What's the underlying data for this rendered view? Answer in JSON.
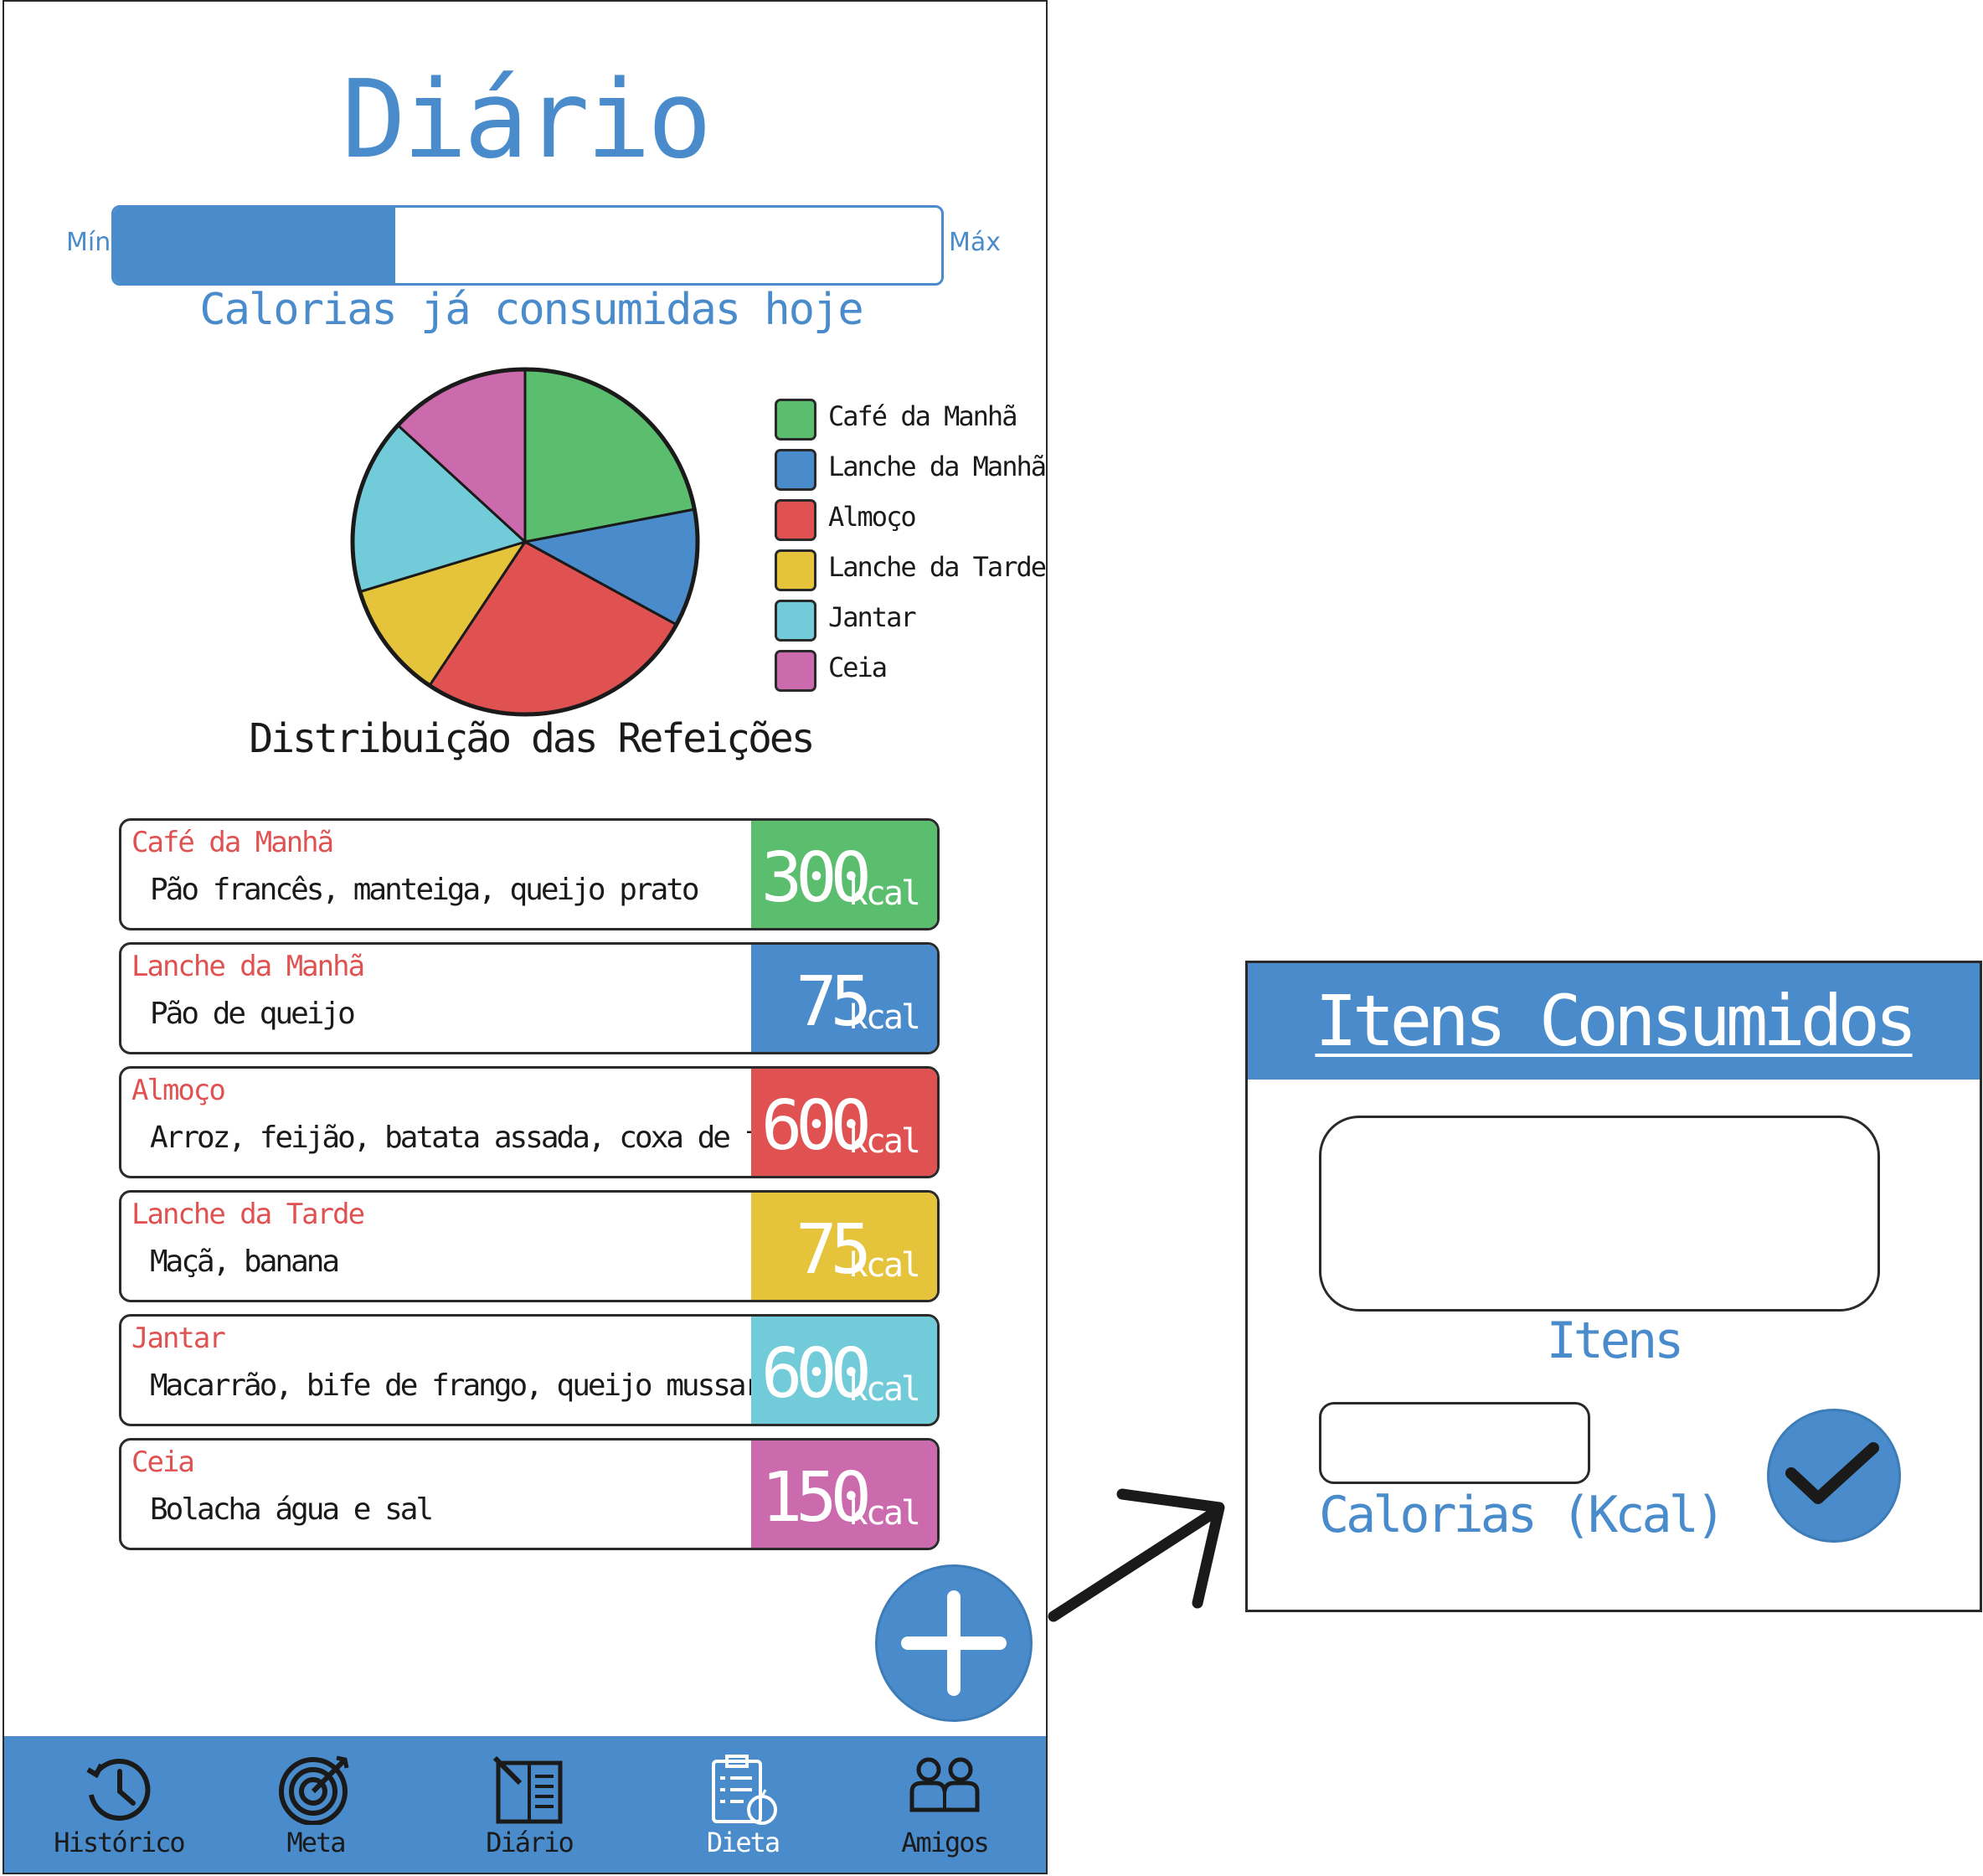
{
  "header": {
    "title": "Diário"
  },
  "calorie_bar": {
    "min_label": "Mín",
    "max_label": "Máx",
    "caption": "Calorias já consumidas hoje",
    "progress": 0.34,
    "color": "#4a8ccb"
  },
  "chart_data": {
    "type": "pie",
    "title": "Distribuição das Refeições",
    "labels": [
      "Café da Manhã",
      "Lanche da Manhã",
      "Almoço",
      "Lanche da Tarde",
      "Jantar",
      "Ceia"
    ],
    "values": [
      20,
      10,
      24,
      10,
      15,
      12
    ],
    "colors": [
      "#5bbd6e",
      "#4a8ccb",
      "#e05252",
      "#e5c33a",
      "#72cbd8",
      "#cc6aae"
    ],
    "legend": "right"
  },
  "meals": [
    {
      "name": "Café da Manhã",
      "items": "Pão francês, manteiga, queijo prato",
      "kcal": "300",
      "unit": "kcal",
      "color": "#5bbd6e"
    },
    {
      "name": "Lanche da Manhã",
      "items": "Pão de queijo",
      "kcal": "75",
      "unit": "kcal",
      "color": "#4a8ccb"
    },
    {
      "name": "Almoço",
      "items": "Arroz, feijão, batata assada, coxa de frango",
      "kcal": "600",
      "unit": "kcal",
      "color": "#e05252"
    },
    {
      "name": "Lanche da Tarde",
      "items": "Maçã, banana",
      "kcal": "75",
      "unit": "kcal",
      "color": "#e5c33a"
    },
    {
      "name": "Jantar",
      "items": "Macarrão, bife de frango, queijo mussarela",
      "kcal": "600",
      "unit": "kcal",
      "color": "#72cbd8"
    },
    {
      "name": "Ceia",
      "items": "Bolacha água e sal",
      "kcal": "150",
      "unit": "kcal",
      "color": "#cc6aae"
    }
  ],
  "add_button": {
    "icon": "plus-icon"
  },
  "nav": [
    {
      "label": "Histórico",
      "icon": "history-icon",
      "active": false
    },
    {
      "label": "Meta",
      "icon": "target-icon",
      "active": false
    },
    {
      "label": "Diário",
      "icon": "diary-icon",
      "active": false
    },
    {
      "label": "Dieta",
      "icon": "diet-checklist-icon",
      "active": true
    },
    {
      "label": "Amigos",
      "icon": "friends-icon",
      "active": false
    }
  ],
  "dialog": {
    "title": "Itens Consumidos",
    "items_label": "Itens",
    "calories_label": "Calorias (Kcal)",
    "confirm_icon": "check-icon"
  }
}
